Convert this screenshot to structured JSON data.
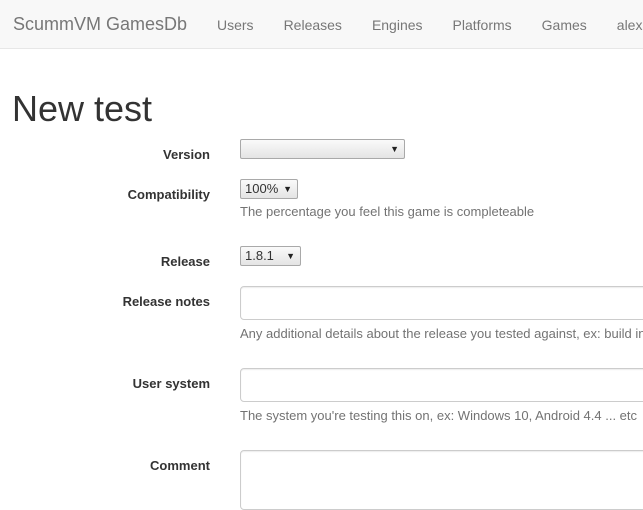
{
  "navbar": {
    "brand": "ScummVM GamesDb",
    "links": [
      "Users",
      "Releases",
      "Engines",
      "Platforms",
      "Games",
      "alexbev"
    ]
  },
  "page": {
    "title": "New test"
  },
  "form": {
    "version": {
      "label": "Version",
      "value": ""
    },
    "compatibility": {
      "label": "Compatibility",
      "value": "100%",
      "help": "The percentage you feel this game is completeable"
    },
    "release": {
      "label": "Release",
      "value": "1.8.1"
    },
    "release_notes": {
      "label": "Release notes",
      "value": "",
      "help": "Any additional details about the release you tested against, ex: build in"
    },
    "user_system": {
      "label": "User system",
      "value": "",
      "help": "The system you're testing this on, ex: Windows 10, Android 4.4 ... etc"
    },
    "comment": {
      "label": "Comment",
      "value": ""
    }
  },
  "icons": {
    "select_arrow": "▼"
  },
  "colors": {
    "navbar_bg": "#f8f8f8",
    "nav_text": "#777777",
    "help_text": "#737373"
  }
}
